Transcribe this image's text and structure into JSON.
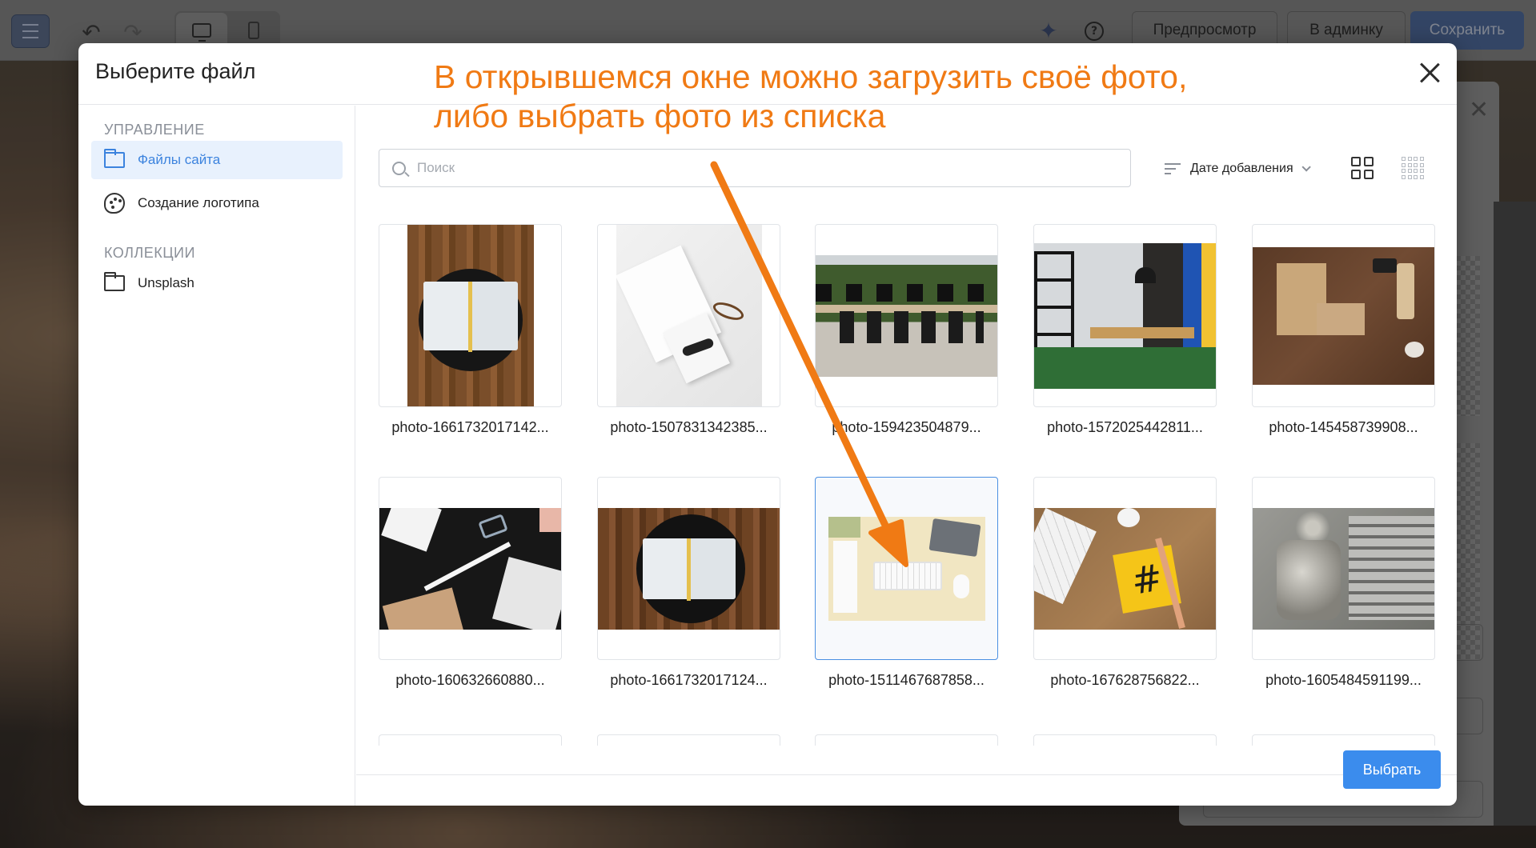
{
  "editor": {
    "preview_label": "Предпросмотр",
    "admin_label": "В админку",
    "save_label": "Сохранить",
    "help_glyph": "?"
  },
  "modal": {
    "title": "Выберите файл",
    "select_label": "Выбрать"
  },
  "sidebar": {
    "sections": [
      {
        "heading": "УПРАВЛЕНИЕ",
        "items": [
          {
            "label": "Файлы сайта",
            "icon": "folder-icon",
            "active": true
          },
          {
            "label": "Создание логотипа",
            "icon": "palette-icon",
            "active": false
          }
        ]
      },
      {
        "heading": "КОЛЛЕКЦИИ",
        "items": [
          {
            "label": "Unsplash",
            "icon": "folder-icon",
            "active": false
          }
        ]
      }
    ]
  },
  "toolbar": {
    "search_placeholder": "Поиск",
    "sort_label": "Дате добавления"
  },
  "files": [
    {
      "name": "photo-1661732017142...",
      "selected": false
    },
    {
      "name": "photo-1507831342385...",
      "selected": false
    },
    {
      "name": "photo-159423504879...",
      "selected": false
    },
    {
      "name": "photo-1572025442811...",
      "selected": false
    },
    {
      "name": "photo-145458739908...",
      "selected": false
    },
    {
      "name": "photo-160632660880...",
      "selected": false
    },
    {
      "name": "photo-1661732017124...",
      "selected": false
    },
    {
      "name": "photo-1511467687858...",
      "selected": true
    },
    {
      "name": "photo-167628756822...",
      "selected": false
    },
    {
      "name": "photo-1605484591199...",
      "selected": false
    }
  ],
  "annotation": {
    "line1": "В открывшемся окне можно загрузить своё фото,",
    "line2": "либо выбрать фото из списка"
  },
  "colors": {
    "accent": "#3b8ced",
    "annotation": "#f07a14",
    "active_bg": "#e8f1fd"
  }
}
